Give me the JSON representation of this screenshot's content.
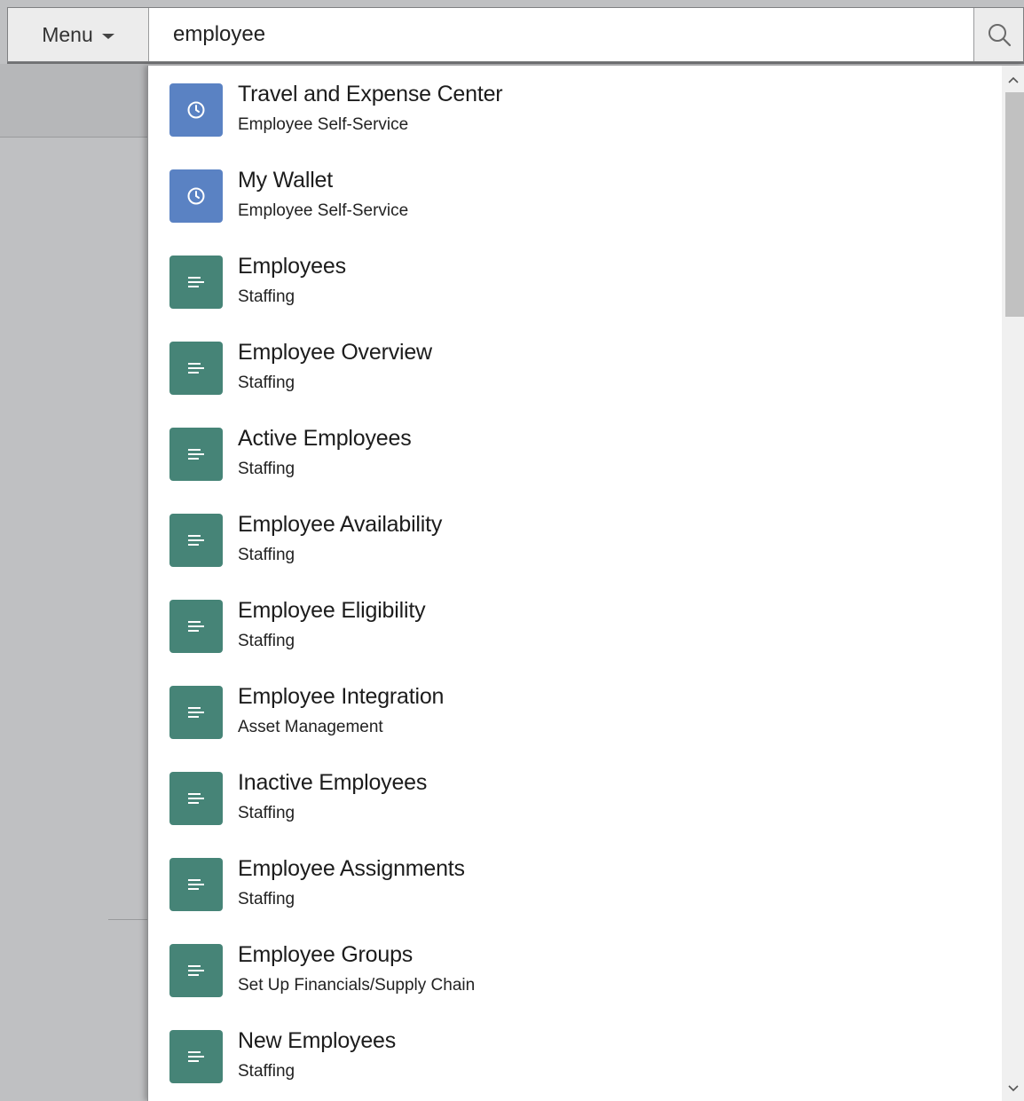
{
  "search": {
    "menu_label": "Menu",
    "query": "employee",
    "search_icon": "search-icon"
  },
  "results": [
    {
      "title": "Travel and Expense Center",
      "subtitle": "Employee Self-Service",
      "icon": "clock-icon"
    },
    {
      "title": "My Wallet",
      "subtitle": "Employee Self-Service",
      "icon": "clock-icon"
    },
    {
      "title": "Employees",
      "subtitle": "Staffing",
      "icon": "page-icon"
    },
    {
      "title": "Employee Overview",
      "subtitle": "Staffing",
      "icon": "page-icon"
    },
    {
      "title": "Active Employees",
      "subtitle": "Staffing",
      "icon": "page-icon"
    },
    {
      "title": "Employee Availability",
      "subtitle": "Staffing",
      "icon": "page-icon"
    },
    {
      "title": "Employee Eligibility",
      "subtitle": "Staffing",
      "icon": "page-icon"
    },
    {
      "title": "Employee Integration",
      "subtitle": "Asset Management",
      "icon": "page-icon"
    },
    {
      "title": "Inactive Employees",
      "subtitle": "Staffing",
      "icon": "page-icon"
    },
    {
      "title": "Employee Assignments",
      "subtitle": "Staffing",
      "icon": "page-icon"
    },
    {
      "title": "Employee Groups",
      "subtitle": "Set Up Financials/Supply Chain",
      "icon": "page-icon"
    },
    {
      "title": "New Employees",
      "subtitle": "Staffing",
      "icon": "page-icon"
    }
  ],
  "colors": {
    "clock_icon_bg": "#5a82c3",
    "page_icon_bg": "#468477"
  }
}
